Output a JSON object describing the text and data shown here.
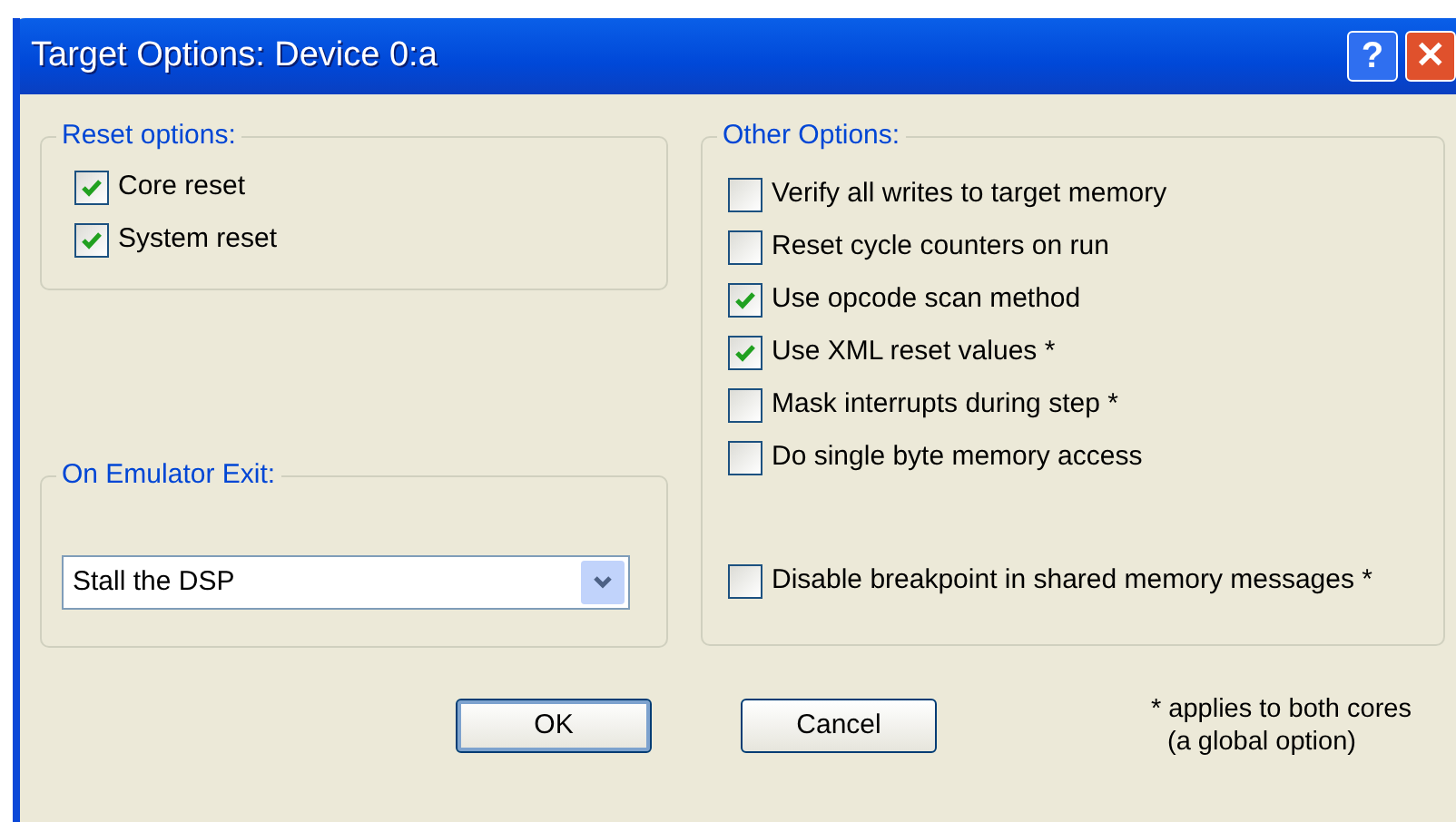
{
  "window": {
    "title": "Target Options: Device 0:a",
    "buttons": [
      {
        "kind": "help",
        "label": "?"
      },
      {
        "kind": "close",
        "label": "✕"
      }
    ]
  },
  "reset_options": {
    "title": "Reset options:",
    "items": [
      {
        "label": "Core reset",
        "checked": true
      },
      {
        "label": "System reset",
        "checked": true
      }
    ]
  },
  "emulator_exit": {
    "title": "On Emulator Exit:",
    "value": "Stall the DSP"
  },
  "other_options": {
    "title": "Other Options:",
    "items": [
      {
        "label": "Verify all writes to target memory",
        "checked": false
      },
      {
        "label": "Reset cycle counters on run",
        "checked": false
      },
      {
        "label": "Use opcode scan method",
        "checked": true
      },
      {
        "label": "Use XML reset values *",
        "checked": true
      },
      {
        "label": "Mask interrupts during step *",
        "checked": false
      },
      {
        "label": "Do single byte memory access",
        "checked": false
      }
    ],
    "bottom_items": [
      {
        "label": "Disable breakpoint in shared memory messages *",
        "checked": false
      }
    ]
  },
  "buttons": [
    "OK",
    "Cancel"
  ],
  "footnote": [
    "* applies to both cores",
    "(a global option)"
  ]
}
